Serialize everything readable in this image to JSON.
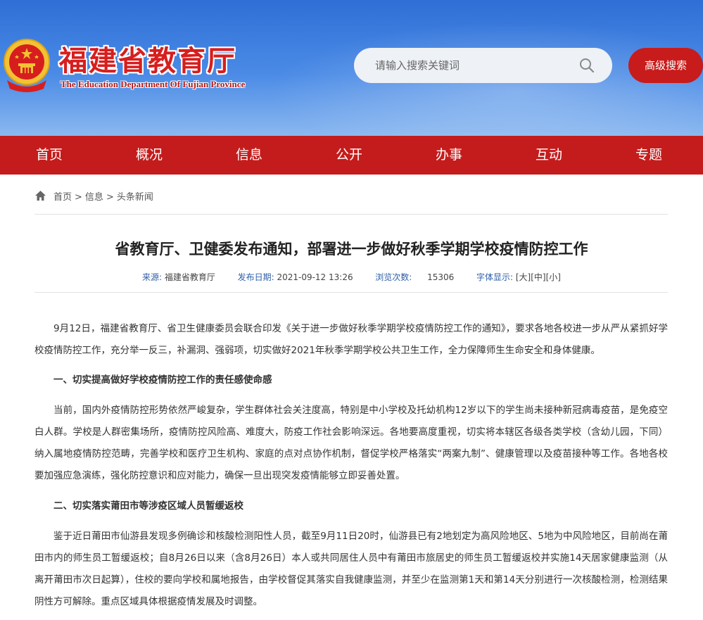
{
  "header": {
    "site_title": "福建省教育厅",
    "site_subtitle": "The Education Department Of Fujian Province",
    "search_placeholder": "请输入搜索关键词",
    "advanced_search_label": "高级搜索"
  },
  "nav": {
    "items": [
      "首页",
      "概况",
      "信息",
      "公开",
      "办事",
      "互动",
      "专题"
    ]
  },
  "breadcrumb": {
    "items": [
      "首页",
      "信息",
      "头条新闻"
    ],
    "separator": ">"
  },
  "article": {
    "title": "省教育厅、卫健委发布通知，部署进一步做好秋季学期学校疫情防控工作",
    "meta": {
      "source_label": "来源:",
      "source_value": "福建省教育厅",
      "date_label": "发布日期:",
      "date_value": "2021-09-12 13:26",
      "views_label": "浏览次数:",
      "views_value": "15306",
      "font_label": "字体显示:",
      "font_large": "[大]",
      "font_medium": "[中]",
      "font_small": "[小]"
    },
    "paragraphs": [
      "9月12日，福建省教育厅、省卫生健康委员会联合印发《关于进一步做好秋季学期学校疫情防控工作的通知》，要求各地各校进一步从严从紧抓好学校疫情防控工作，充分举一反三，补漏洞、强弱项，切实做好2021年秋季学期学校公共卫生工作，全力保障师生生命安全和身体健康。",
      "一、切实提高做好学校疫情防控工作的责任感使命感",
      "当前，国内外疫情防控形势依然严峻复杂，学生群体社会关注度高，特别是中小学校及托幼机构12岁以下的学生尚未接种新冠病毒疫苗，是免疫空白人群。学校是人群密集场所，疫情防控风险高、难度大，防疫工作社会影响深远。各地要高度重视，切实将本辖区各级各类学校（含幼儿园，下同）纳入属地疫情防控范畴，完善学校和医疗卫生机构、家庭的点对点协作机制，督促学校严格落实“两案九制”、健康管理以及疫苗接种等工作。各地各校要加强应急演练，强化防控意识和应对能力，确保一旦出现突发疫情能够立即妥善处置。",
      "二、切实落实莆田市等涉疫区域人员暂缓返校",
      "鉴于近日莆田市仙游县发现多例确诊和核酸检测阳性人员，截至9月11日20时，仙游县已有2地划定为高风险地区、5地为中风险地区，目前尚在莆田市内的师生员工暂缓返校；自8月26日以来（含8月26日）本人或共同居住人员中有莆田市旅居史的师生员工暂缓返校并实施14天居家健康监测（从离开莆田市次日起算），住校的要向学校和属地报告，由学校督促其落实自我健康监测，并至少在监测第1天和第14天分别进行一次核酸检测，检测结果阴性方可解除。重点区域具体根据疫情发展及时调整。"
    ]
  },
  "colors": {
    "nav_red": "#c41c1c",
    "button_red": "#c81b1b",
    "meta_blue": "#2d5fa8"
  }
}
